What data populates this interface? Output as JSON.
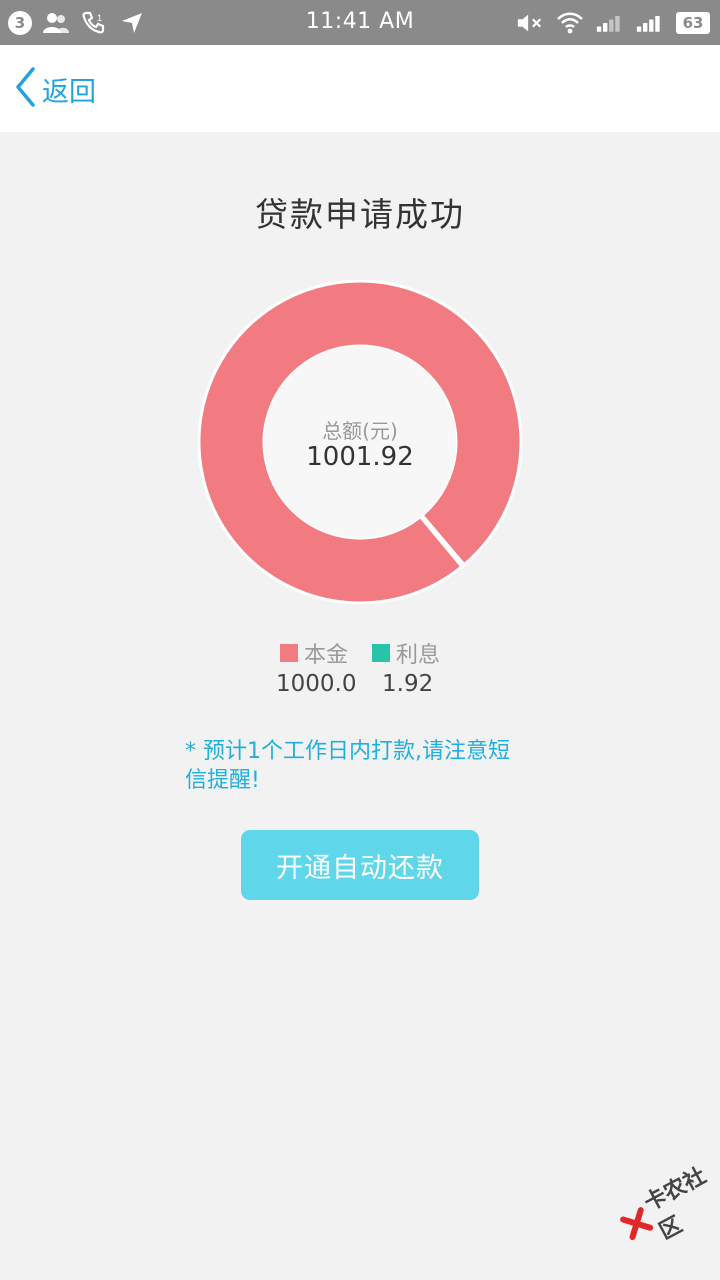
{
  "status_bar": {
    "notification_count": "3",
    "time": "11:41 AM",
    "battery": "63",
    "icons": [
      "contacts-icon",
      "missed-call-icon",
      "location-arrow-icon",
      "mute-icon",
      "wifi-icon",
      "signal-icon",
      "signal-icon"
    ]
  },
  "nav": {
    "back_label": "返回",
    "back_icon": "chevron-left-icon"
  },
  "page": {
    "title": "贷款申请成功"
  },
  "chart_data": {
    "type": "pie",
    "donut": true,
    "center_label": "总额(元)",
    "center_value": "1001.92",
    "series": [
      {
        "name": "本金",
        "value": 1000.0,
        "value_label": "1000.0",
        "color": "#f27b82"
      },
      {
        "name": "利息",
        "value": 1.92,
        "value_label": "1.92",
        "color": "#28c4a8"
      }
    ]
  },
  "notice": {
    "text": "* 预计1个工作日内打款,请注意短信提醒!"
  },
  "cta": {
    "label": "开通自动还款"
  },
  "watermark": {
    "text": "卡农社区"
  },
  "colors": {
    "status_bar_bg": "#8a8a8a",
    "accent_blue": "#21a3e0",
    "notice_text": "#1fb0dc",
    "button_bg": "#5fd6ea",
    "principal": "#f27b82",
    "interest": "#28c4a8",
    "page_bg": "#f2f2f2"
  }
}
